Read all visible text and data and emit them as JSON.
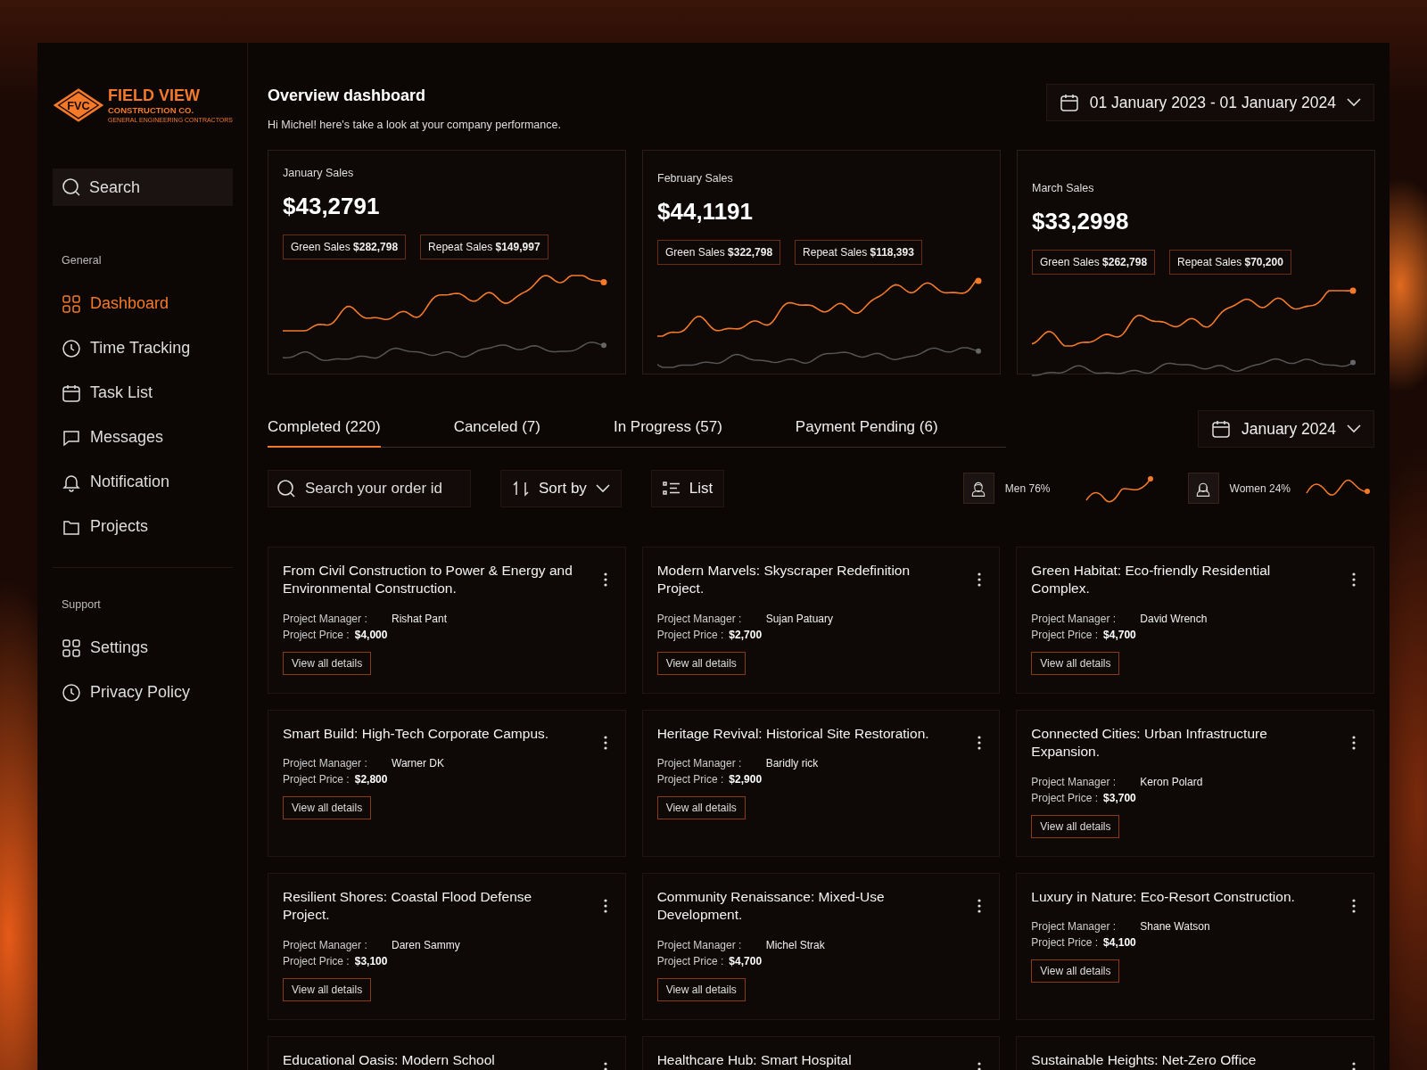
{
  "logo": {
    "initials": "FVC",
    "name": "FIELD VIEW",
    "line2": "CONSTRUCTION CO.",
    "tagline": "GENERAL ENGINEERING CONTRACTORS"
  },
  "search": {
    "placeholder": "Search"
  },
  "nav_sections": [
    {
      "heading": "General",
      "items": [
        {
          "label": "Dashboard",
          "selected": true
        },
        {
          "label": "Time Tracking",
          "selected": false
        },
        {
          "label": "Task List",
          "selected": false
        },
        {
          "label": "Messages",
          "selected": false
        },
        {
          "label": "Notification",
          "selected": false
        },
        {
          "label": "Projects",
          "selected": false
        }
      ]
    },
    {
      "heading": "Support",
      "items": [
        {
          "label": "Settings",
          "selected": false
        },
        {
          "label": "Privacy Policy",
          "selected": false
        }
      ]
    }
  ],
  "header": {
    "title": "Overview dashboard",
    "subtitle": "Hi Michel! here's take a look at your company performance.",
    "date_range": "01 January 2023 - 01 January 2024"
  },
  "stats": [
    {
      "label": "January Sales",
      "value": "$43,2791",
      "chips": [
        "Green Sales **$282,798**",
        "Repeat Sales **$149,997**"
      ]
    },
    {
      "label": "February Sales",
      "value": "$44,1191",
      "chips": [
        "Green Sales **$322,798**",
        "Repeat Sales **$118,393**"
      ]
    },
    {
      "label": "March Sales",
      "value": "$33,2998",
      "chips": [
        "Green Sales **$262,798**",
        "Repeat Sales **$70,200**"
      ]
    }
  ],
  "tabs": [
    {
      "label": "Completed (220)",
      "selected": true
    },
    {
      "label": "Canceled (7)",
      "selected": false
    },
    {
      "label": "In Progress (57)",
      "selected": false
    },
    {
      "label": "Payment Pending (6)",
      "selected": false
    }
  ],
  "month_picker": "January 2024",
  "order_search": {
    "placeholder": "Search your order id"
  },
  "sort_button": "Sort by",
  "view_button": "List",
  "demographics": [
    {
      "label": "Men 76%"
    },
    {
      "label": "Women 24%"
    }
  ],
  "projects": [
    {
      "kind": "full",
      "title": "From Civil Construction to Power & Energy and Environmental Construction.",
      "manager_label": "Project Manager :",
      "manager": "Rishat Pant",
      "price_label": "Project Price :",
      "price": "$4,000",
      "action": "View all details"
    },
    {
      "kind": "full",
      "title": "Modern Marvels: Skyscraper Redefinition Project.",
      "manager_label": "Project Manager :",
      "manager": "Sujan Patuary",
      "price_label": "Project Price :",
      "price": "$2,700",
      "action": "View all details"
    },
    {
      "kind": "full",
      "title": "Green Habitat: Eco-friendly Residential Complex.",
      "manager_label": "Project Manager :",
      "manager": "David Wrench",
      "price_label": "Project Price :",
      "price": "$4,700",
      "action": "View all details"
    },
    {
      "kind": "full",
      "title": "Smart Build: High-Tech Corporate Campus.",
      "manager_label": "Project Manager :",
      "manager": "Warner DK",
      "price_label": "Project Price :",
      "price": "$2,800",
      "action": "View all details"
    },
    {
      "kind": "full",
      "title": "Heritage Revival: Historical Site Restoration.",
      "manager_label": "Project Manager :",
      "manager": "Baridly rick",
      "price_label": "Project Price :",
      "price": "$2,900",
      "action": "View all details"
    },
    {
      "kind": "full",
      "title": "Connected Cities: Urban Infrastructure Expansion.",
      "manager_label": "Project Manager :",
      "manager": "Keron Polard",
      "price_label": "Project Price :",
      "price": "$3,700",
      "action": "View all details"
    },
    {
      "kind": "full",
      "title": "Resilient Shores: Coastal Flood Defense Project.",
      "manager_label": "Project Manager :",
      "manager": "Daren Sammy",
      "price_label": "Project Price :",
      "price": "$3,100",
      "action": "View all details"
    },
    {
      "kind": "full",
      "title": "Community Renaissance: Mixed-Use Development.",
      "manager_label": "Project Manager :",
      "manager": "Michel Strak",
      "price_label": "Project Price :",
      "price": "$4,700",
      "action": "View all details"
    },
    {
      "kind": "full",
      "title": "Luxury in Nature: Eco-Resort Construction.",
      "manager_label": "Project Manager :",
      "manager": "Shane Watson",
      "price_label": "Project Price :",
      "price": "$4,100",
      "action": "View all details"
    },
    {
      "kind": "partial",
      "title": "Educational Oasis: Modern School"
    },
    {
      "kind": "partial",
      "title": "Healthcare Hub: Smart Hospital"
    },
    {
      "kind": "partial",
      "title": "Sustainable Heights: Net-Zero Office"
    }
  ]
}
